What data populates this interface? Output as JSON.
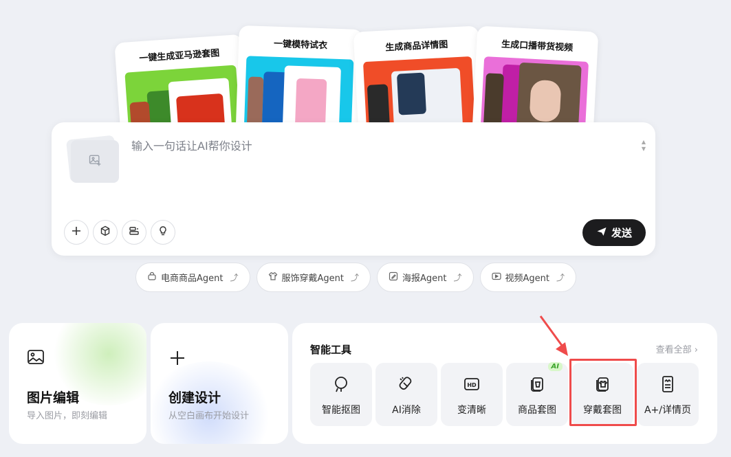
{
  "feature_cards": [
    {
      "title": "一键生成亚马逊套图"
    },
    {
      "title": "一键模特试衣"
    },
    {
      "title": "生成商品详情图"
    },
    {
      "title": "生成口播带货视频"
    }
  ],
  "prompt": {
    "placeholder": "输入一句话让AI帮你设计",
    "send_label": "发送"
  },
  "agents": [
    {
      "label": "电商商品Agent",
      "icon": "bag-icon"
    },
    {
      "label": "服饰穿戴Agent",
      "icon": "clothing-icon"
    },
    {
      "label": "海报Agent",
      "icon": "edit-icon"
    },
    {
      "label": "视频Agent",
      "icon": "video-icon"
    }
  ],
  "agent_arrow": "⤴",
  "cards": {
    "image_edit": {
      "title": "图片编辑",
      "subtitle": "导入图片，即刻编辑"
    },
    "create_design": {
      "title": "创建设计",
      "subtitle": "从空白画布开始设计"
    }
  },
  "smart_tools": {
    "title": "智能工具",
    "see_all": "查看全部",
    "items": [
      {
        "label": "智能抠图",
        "icon": "cutout-icon"
      },
      {
        "label": "AI消除",
        "icon": "eraser-icon"
      },
      {
        "label": "变清晰",
        "icon": "hd-icon"
      },
      {
        "label": "商品套图",
        "icon": "product-set-icon",
        "badge": "AI"
      },
      {
        "label": "穿戴套图",
        "icon": "wear-set-icon"
      },
      {
        "label": "A+/详情页",
        "icon": "detail-page-icon"
      }
    ]
  },
  "colors": {
    "highlight": "#ef4b4b",
    "send_bg": "#1c1c1e"
  }
}
